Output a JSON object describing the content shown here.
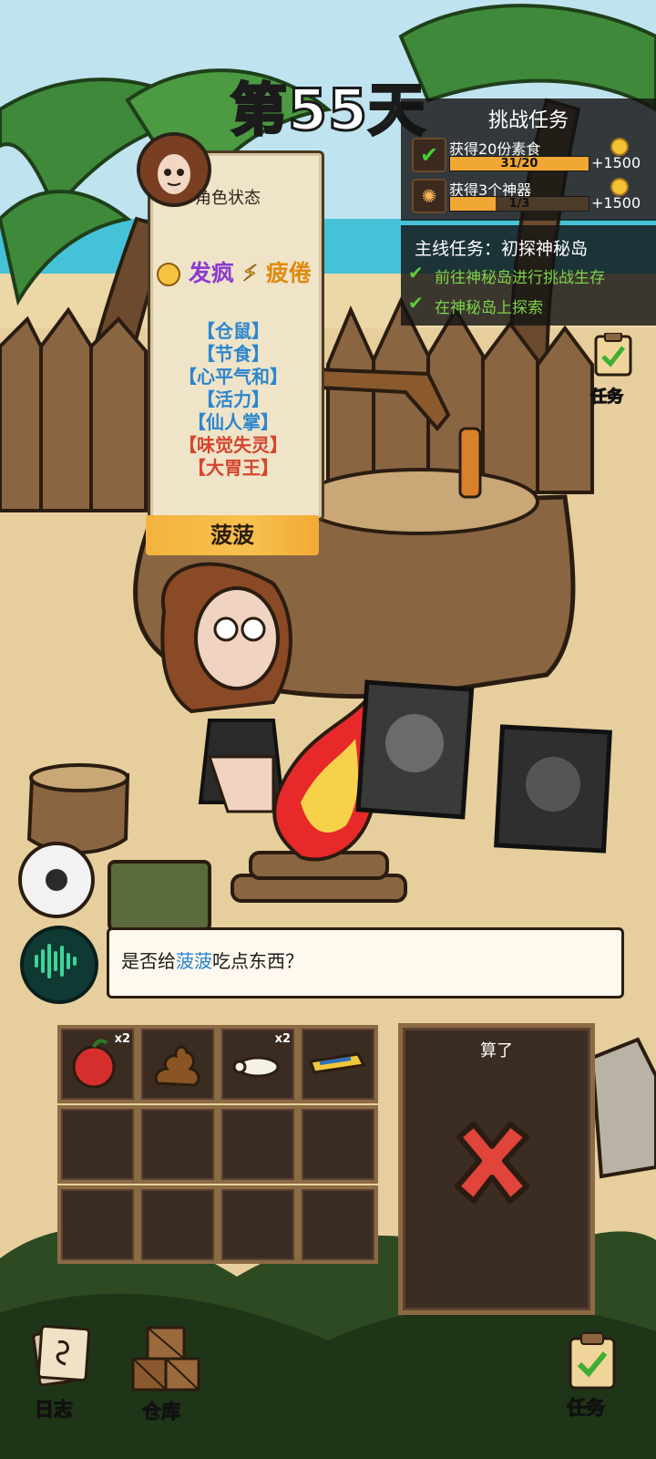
{
  "header": {
    "day_title": "第55天"
  },
  "status": {
    "title": "角色状态",
    "moods": [
      {
        "label": "发疯",
        "color": "#8a3bd0"
      },
      {
        "label": "疲倦",
        "color": "#e08a12"
      }
    ],
    "traits": [
      {
        "label": "【仓鼠】",
        "color": "#2c86cf"
      },
      {
        "label": "【节食】",
        "color": "#2c86cf"
      },
      {
        "label": "【心平气和】",
        "color": "#2c86cf"
      },
      {
        "label": "【活力】",
        "color": "#2c86cf"
      },
      {
        "label": "【仙人掌】",
        "color": "#2c86cf"
      },
      {
        "label": "【味觉失灵】",
        "color": "#d6452e"
      },
      {
        "label": "【大胃王】",
        "color": "#d6452e"
      }
    ],
    "character_name": "菠菠"
  },
  "challenge": {
    "title": "挑战任务",
    "tasks": [
      {
        "label": "获得20份素食",
        "progress": "31/20",
        "fraction": 1.0,
        "reward": "+1500",
        "icon": "check-icon"
      },
      {
        "label": "获得3个神器",
        "progress": "1/3",
        "fraction": 0.333,
        "reward": "+1500",
        "icon": "artifact-icon"
      }
    ]
  },
  "main_quest": {
    "title": "主线任务：初探神秘岛",
    "steps": [
      "前往神秘岛进行挑战生存",
      "在神秘岛上探索"
    ]
  },
  "side_task_label": "任务",
  "dialog": {
    "prefix": "是否给",
    "name": "菠菠",
    "suffix": "吃点东西？"
  },
  "inventory": {
    "items": [
      {
        "name": "apple-icon",
        "count": "x2"
      },
      {
        "name": "poop-icon",
        "count": ""
      },
      {
        "name": "grub-icon",
        "count": "x2"
      },
      {
        "name": "toothpaste-icon",
        "count": ""
      }
    ],
    "skip_label": "算了"
  },
  "nav": {
    "diary": "日志",
    "warehouse": "仓库",
    "tasks": "任务"
  },
  "colors": {
    "accent": "#f1a733",
    "name_blue": "#2c86cf",
    "cancel_red": "#e0443a"
  }
}
